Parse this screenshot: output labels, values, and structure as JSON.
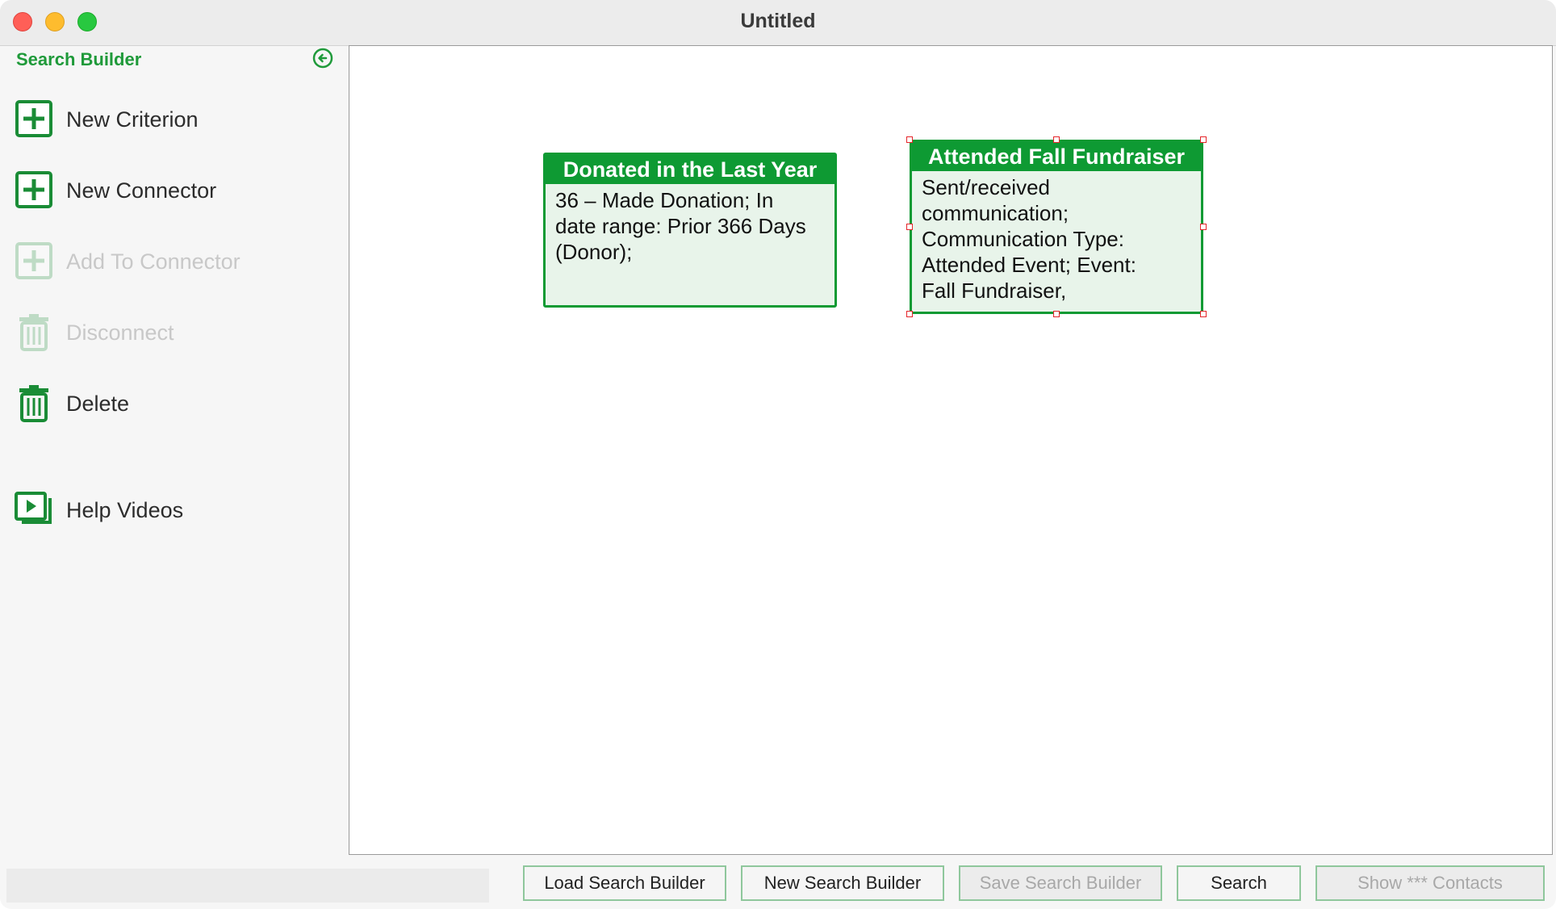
{
  "window": {
    "title": "Untitled"
  },
  "sidebar": {
    "header": "Search Builder",
    "items": [
      {
        "label": "New Criterion",
        "icon": "plus-square-icon",
        "enabled": true
      },
      {
        "label": "New Connector",
        "icon": "plus-square-icon",
        "enabled": true
      },
      {
        "label": "Add To Connector",
        "icon": "plus-square-icon",
        "enabled": false
      },
      {
        "label": "Disconnect",
        "icon": "trash-icon",
        "enabled": false
      },
      {
        "label": "Delete",
        "icon": "trash-icon",
        "enabled": true
      },
      {
        "label": "Help Videos",
        "icon": "play-video-icon",
        "enabled": true
      }
    ]
  },
  "canvas": {
    "nodes": [
      {
        "title": "Donated in the Last Year",
        "body": "36 – Made Donation; In\ndate range: Prior 366 Days\n(Donor);",
        "selected": false
      },
      {
        "title": "Attended Fall Fundraiser",
        "body": "Sent/received\ncommunication;\nCommunication Type:\nAttended Event; Event:\nFall Fundraiser,",
        "selected": true
      }
    ]
  },
  "footer": {
    "status_text": "",
    "buttons": [
      {
        "label": "Load Search Builder",
        "enabled": true
      },
      {
        "label": "New Search Builder",
        "enabled": true
      },
      {
        "label": "Save Search Builder",
        "enabled": false
      },
      {
        "label": "Search",
        "enabled": true
      },
      {
        "label": "Show *** Contacts",
        "enabled": false
      }
    ]
  },
  "colors": {
    "accent": "#0e9a33",
    "node_fill": "#e8f4ea",
    "handle": "#e5252a"
  }
}
